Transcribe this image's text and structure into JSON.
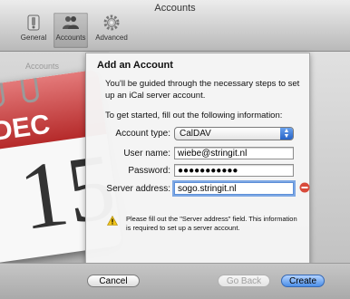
{
  "window": {
    "title": "Accounts"
  },
  "toolbar": [
    {
      "label": "General",
      "icon": "switch-icon",
      "active": false
    },
    {
      "label": "Accounts",
      "icon": "people-icon",
      "active": true
    },
    {
      "label": "Advanced",
      "icon": "gear-icon",
      "active": false
    }
  ],
  "background": {
    "accounts_label": "Accounts",
    "calendar_month": "DEC",
    "calendar_day": "15"
  },
  "sheet": {
    "title": "Add an Account",
    "intro": "You'll be guided through the necessary steps to set up an iCal server account.",
    "instruction": "To get started, fill out the following information:",
    "fields": {
      "account_type": {
        "label": "Account type:",
        "value": "CalDAV"
      },
      "user_name": {
        "label": "User name:",
        "value": "wiebe@stringit.nl"
      },
      "password": {
        "label": "Password:",
        "value": "●●●●●●●●●●●"
      },
      "server_address": {
        "label": "Server address:",
        "value": "sogo.stringit.nl"
      }
    },
    "warning": "Please fill out the \"Server address\" field. This information is required to set up a server account."
  },
  "buttons": {
    "cancel": "Cancel",
    "go_back": "Go Back",
    "create": "Create"
  },
  "colors": {
    "accent": "#2a6ad6",
    "error": "#d84a3a",
    "calendar_red": "#c0392b",
    "warning": "#f0c419"
  }
}
